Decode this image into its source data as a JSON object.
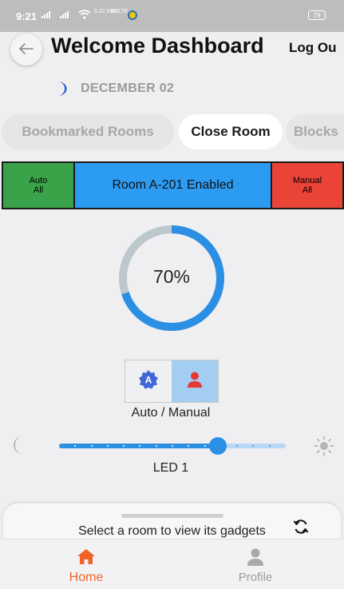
{
  "status_bar": {
    "time": "9:21",
    "speed": "0.22 KB/S",
    "volte": "Vo LTE",
    "battery": "79"
  },
  "header": {
    "title": "Welcome Dashboard",
    "logout_label": "Log Ou",
    "back_icon": "arrow-left-icon"
  },
  "date": {
    "label": "DECEMBER 02",
    "icon": "moon-icon"
  },
  "tabs": [
    {
      "label": "Bookmarked Rooms",
      "active": false
    },
    {
      "label": "Close Room",
      "active": true
    },
    {
      "label": "Blocks",
      "active": false
    }
  ],
  "mode_bar": {
    "auto_line1": "Auto",
    "auto_line2": "All",
    "room_status": "Room A-201 Enabled",
    "manual_line1": "Manual",
    "manual_line2": "All",
    "colors": {
      "auto": "#3aa34a",
      "room": "#2c9cf2",
      "manual": "#ea4337"
    }
  },
  "gauge": {
    "value_label": "70%",
    "value": 0.7,
    "colors": {
      "fill": "#2b8fe3",
      "track": "#bcc8cc"
    }
  },
  "mode_toggle": {
    "label": "Auto / Manual",
    "selected": "manual",
    "auto_icon": "auto-a-badge-icon",
    "manual_icon": "person-icon"
  },
  "led_slider": {
    "label": "LED 1",
    "value": 0.7,
    "divisions": 14,
    "low_icon": "moon-icon",
    "high_icon": "sun-icon"
  },
  "bottom_sheet": {
    "hint": "Select a room to view its gadgets",
    "refresh_icon": "refresh-icon"
  },
  "nav": {
    "home_label": "Home",
    "profile_label": "Profile",
    "active_color": "#f06225"
  }
}
